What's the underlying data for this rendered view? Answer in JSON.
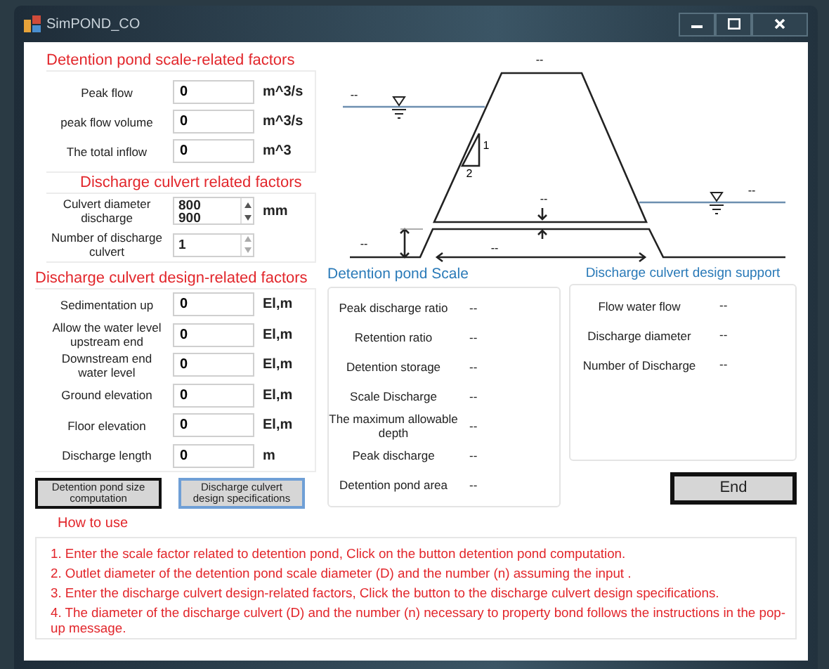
{
  "window": {
    "title": "SimPOND_CO"
  },
  "scale_factors": {
    "title": "Detention pond scale-related factors",
    "fields": [
      {
        "label": "Peak flow",
        "value": "0",
        "unit": "m^3/s"
      },
      {
        "label": "peak flow volume",
        "value": "0",
        "unit": "m^3/s"
      },
      {
        "label": "The total inflow",
        "value": "0",
        "unit": "m^3"
      }
    ]
  },
  "culvert_factors": {
    "title": "Discharge culvert  related factors",
    "diameter": {
      "label": "Culvert diameter discharge",
      "values": [
        "800",
        "900"
      ],
      "unit": "mm"
    },
    "count": {
      "label": "Number of discharge culvert",
      "value": "1"
    }
  },
  "design_factors": {
    "title": "Discharge culvert design-related factors",
    "fields": [
      {
        "label": "Sedimentation up",
        "value": "0",
        "unit": "El,m"
      },
      {
        "label": "Allow the water level upstream end",
        "value": "0",
        "unit": "El,m"
      },
      {
        "label": "Downstream end water level",
        "value": "0",
        "unit": "El,m"
      },
      {
        "label": "Ground elevation",
        "value": "0",
        "unit": "El,m"
      },
      {
        "label": "Floor elevation",
        "value": "0",
        "unit": "El,m"
      },
      {
        "label": "Discharge length",
        "value": "0",
        "unit": "m"
      }
    ]
  },
  "buttons": [
    {
      "label": "Detention pond size computation",
      "focused": false
    },
    {
      "label": "Discharge culvert design specifications",
      "focused": true
    }
  ],
  "diagram": {
    "labels": [
      "--",
      "--",
      "1",
      "2",
      "--",
      "--",
      "--",
      "--"
    ]
  },
  "pond_scale": {
    "title": "Detention pond Scale",
    "rows": [
      {
        "label": "Peak discharge ratio",
        "value": "--"
      },
      {
        "label": "Retention ratio",
        "value": "--"
      },
      {
        "label": "Detention storage",
        "value": "--"
      },
      {
        "label": "Scale Discharge",
        "value": "--"
      },
      {
        "label": "The maximum allowable depth",
        "value": "--"
      },
      {
        "label": "Peak discharge",
        "value": "--"
      },
      {
        "label": "Detention pond area",
        "value": "--"
      }
    ]
  },
  "culvert_support": {
    "title": "Discharge culvert design support",
    "rows": [
      {
        "label": "Flow water flow",
        "value": "--"
      },
      {
        "label": "Discharge diameter",
        "value": "--"
      },
      {
        "label": "Number of Discharge",
        "value": "--"
      }
    ]
  },
  "end_button": {
    "label": "End"
  },
  "how_to_use": {
    "title": "How to use",
    "steps": [
      "1. Enter the scale factor related to detention pond, Click on the button detention pond computation.",
      "2.  Outlet diameter of the detention pond scale  diameter (D) and the number (n) assuming the input .",
      "3. Enter the discharge culvert design-related factors, Click the button to the discharge culvert design specifications.",
      "4. The diameter of the discharge culvert (D) and the number (n) necessary to property bond follows the instructions in the pop-up message."
    ]
  }
}
